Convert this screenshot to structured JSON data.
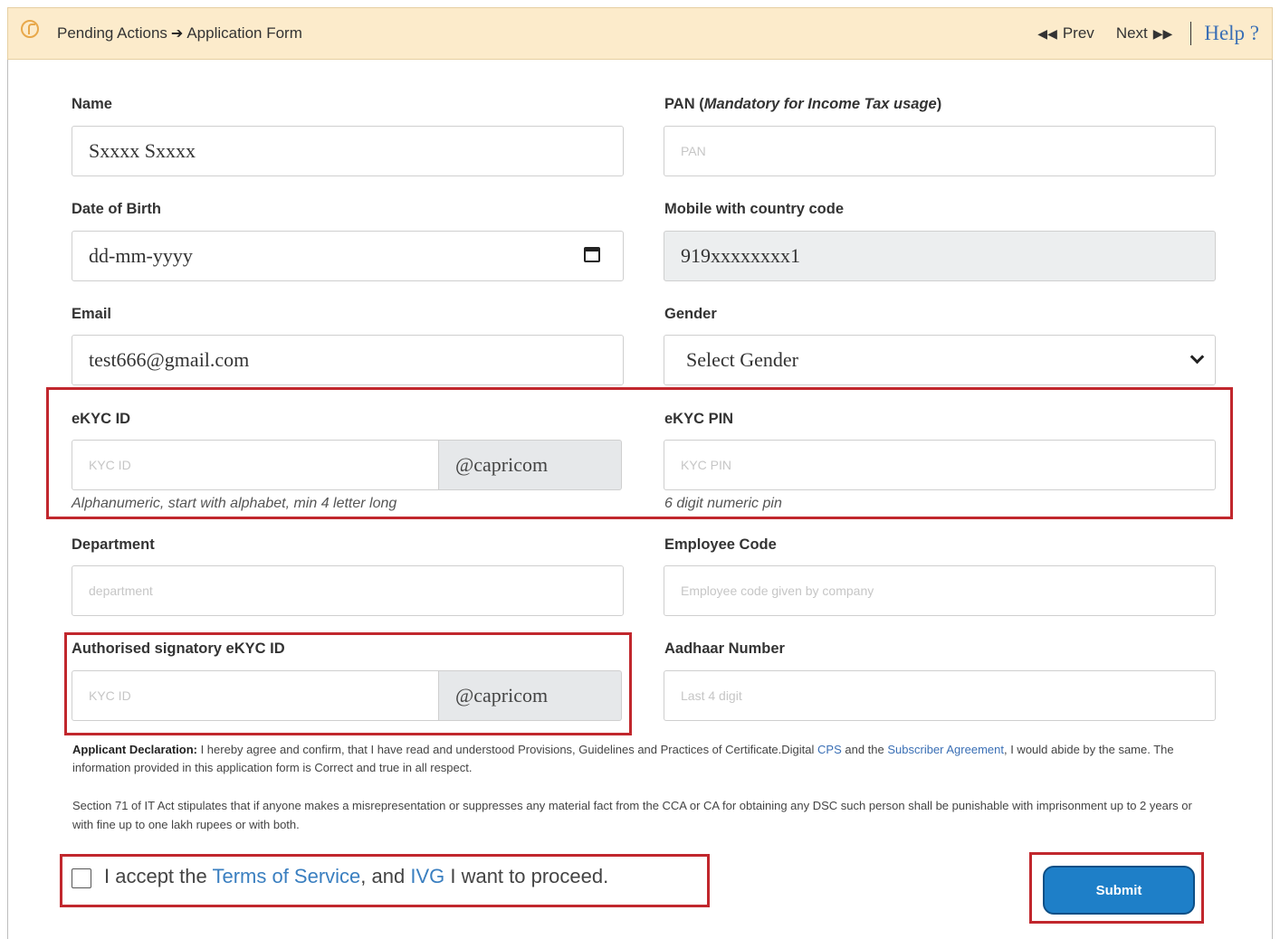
{
  "header": {
    "breadcrumb_1": "Pending Actions",
    "breadcrumb_2": "Application Form",
    "prev_label": "Prev",
    "next_label": "Next",
    "help_label": "Help ?"
  },
  "form": {
    "name": {
      "label": "Name",
      "value": "Sxxxx Sxxxx"
    },
    "pan": {
      "label": "PAN (",
      "label_em": "Mandatory for Income Tax usage",
      "label_end": ")",
      "placeholder": "PAN"
    },
    "dob": {
      "label": "Date of Birth",
      "value": "dd-mm-yyyy"
    },
    "mobile": {
      "label": "Mobile with country code",
      "value": "919xxxxxxxx1"
    },
    "email": {
      "label": "Email",
      "value": "test666@gmail.com"
    },
    "gender": {
      "label": "Gender",
      "value": "Select Gender"
    },
    "ekyc_id": {
      "label": "eKYC ID",
      "placeholder": "KYC ID",
      "suffix": "@capricom",
      "hint": "Alphanumeric, start with alphabet, min 4 letter long"
    },
    "ekyc_pin": {
      "label": "eKYC PIN",
      "placeholder": "KYC PIN",
      "hint": "6 digit numeric pin"
    },
    "department": {
      "label": "Department",
      "placeholder": "department"
    },
    "employee_code": {
      "label": "Employee Code",
      "placeholder": "Employee code given by company"
    },
    "auth_ekyc": {
      "label": "Authorised signatory eKYC ID",
      "placeholder": "KYC ID",
      "suffix": "@capricom"
    },
    "aadhaar": {
      "label": "Aadhaar Number",
      "placeholder": "Last 4 digit"
    }
  },
  "declaration": {
    "title": "Applicant Declaration:",
    "text_1": " I hereby agree and confirm, that I have read and understood Provisions, Guidelines and Practices of Certificate.Digital ",
    "link_cps": "CPS",
    "text_2": " and the ",
    "link_agreement": "Subscriber Agreement",
    "text_3": ", I would abide by the same. The information provided in this application form is Correct and true in all respect.",
    "section71": "Section 71 of IT Act stipulates that if anyone makes a misrepresentation or suppresses any material fact from the CCA or CA for obtaining any DSC such person shall be punishable with imprisonment up to 2 years or with fine up to one lakh rupees or with both."
  },
  "accept": {
    "text_1": "I accept the ",
    "link_terms": "Terms of Service",
    "text_2": ", and ",
    "link_ivg": "IVG",
    "text_3": " I want to proceed."
  },
  "submit_label": "Submit",
  "colors": {
    "highlight": "#c1272d",
    "submit": "#1e7fc8",
    "header_bg": "#fcebcb"
  }
}
